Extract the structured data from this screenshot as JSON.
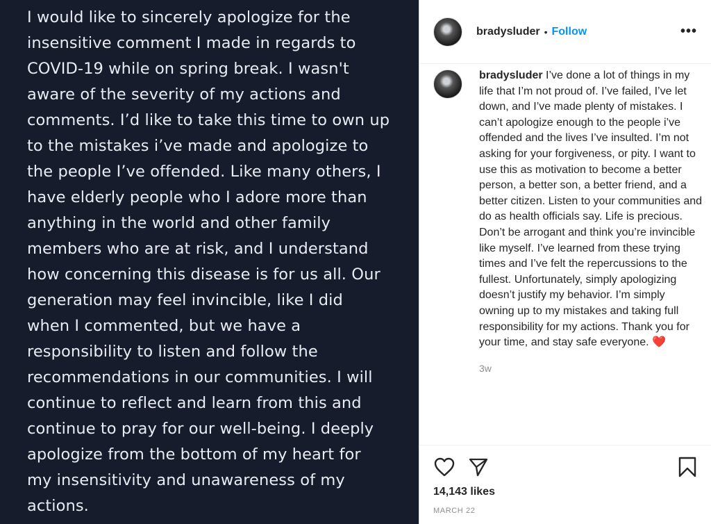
{
  "media": {
    "text": "I would like to sincerely apologize for the\ninsensitive comment I made in regards to\nCOVID-19 while on spring break. I wasn't\naware of the severity of my actions and\ncomments. I’d like to take this time to own up\nto the mistakes i’ve made and apologize to\nthe people I’ve offended. Like many others, I\nhave elderly people who I adore more than\nanything in the world and other family\nmembers who are at risk, and I understand\nhow concerning this disease is for us all. Our\ngeneration may feel invincible, like I did\nwhen I commented, but we have a\nresponsibility to listen and follow the\nrecommendations in our communities. I will\ncontinue to reflect and learn from this and\ncontinue to pray for our well-being. I deeply\napologize from the bottom of my heart for\nmy insensitivity and unawareness of my\nactions."
  },
  "header": {
    "username": "bradysluder",
    "separator": "•",
    "follow_label": "Follow",
    "more_label": "•••"
  },
  "caption": {
    "username": "bradysluder",
    "text": "I’ve done a lot of things in my life that I’m not proud of. I’ve failed, I’ve let down, and I’ve made plenty of mistakes. I can’t apologize enough to the people i’ve offended and the lives I’ve insulted. I’m not asking for your forgiveness, or pity. I want to use this as motivation to become a better person, a better son, a better friend, and a better citizen. Listen to your communities and do as health officials say. Life is precious. Don’t be arrogant and think you’re invincible like myself. I’ve learned from these trying times and I’ve felt the repercussions to the fullest. Unfortunately, simply apologizing doesn’t justify my behavior. I’m simply owning up to my mistakes and taking full responsibility for my actions. Thank you for your time, and stay safe everyone.",
    "emoji": "❤️",
    "time": "3w"
  },
  "actions": {
    "like_icon": "heart-icon",
    "share_icon": "paper-plane-icon",
    "save_icon": "bookmark-icon",
    "likes": "14,143 likes",
    "date": "MARCH 22"
  },
  "colors": {
    "media_bg": "#161c2b",
    "follow": "#0095f6",
    "heart_emoji": "#e0245e"
  }
}
